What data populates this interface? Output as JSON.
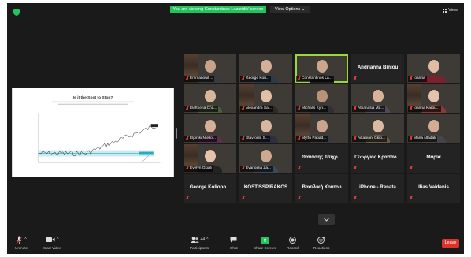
{
  "top_bar": {
    "banner": "You are viewing Constantinos Lazaridis' screen",
    "view_options": "View Options",
    "view_label": "View"
  },
  "shared_slide": {
    "title": "Is it the Spot to Stop?"
  },
  "participants": [
    {
      "name": "Emmanouil ...",
      "style": "video",
      "face": "#c7a489",
      "shirt": "#3a3a3a",
      "muted": true
    },
    {
      "name": "George Kou...",
      "style": "video",
      "face": "#d4b096",
      "shirt": "#2c3a4a",
      "muted": true
    },
    {
      "name": "Constantinos La...",
      "style": "video",
      "face": "#caa68c",
      "shirt": "#1e1e1e",
      "muted": true,
      "active": true
    },
    {
      "name": "Andrianna Biniou",
      "style": "name",
      "muted": true
    },
    {
      "name": "Ioanna",
      "style": "video",
      "face": "#e0bca4",
      "shirt": "#7a2130",
      "muted": true
    },
    {
      "name": "Eleftheria Cha...",
      "style": "video",
      "face": "#d9b59c",
      "shirt": "#4c5c3c",
      "muted": true
    },
    {
      "name": "Alexandra Sa...",
      "style": "video",
      "face": "#e2c0a8",
      "shirt": "#2a2a2a",
      "muted": true
    },
    {
      "name": "Michalis Kyri...",
      "style": "video",
      "face": "#b89378",
      "shirt": "#303030",
      "muted": true
    },
    {
      "name": "Athanasia Ma...",
      "style": "video",
      "face": "#d8b39a",
      "shirt": "#4a4a5a",
      "muted": true
    },
    {
      "name": "Ioanna Karou...",
      "style": "video",
      "face": "#e4c3aa",
      "shirt": "#8a3a3a",
      "muted": true
    },
    {
      "name": "Elpiniki Ntelio...",
      "style": "video",
      "face": "#d6b197",
      "shirt": "#5a3050",
      "muted": true
    },
    {
      "name": "Stavroula S...",
      "style": "video",
      "face": "#d9b69e",
      "shirt": "#2e2e3e",
      "muted": true
    },
    {
      "name": "Myrto Papad...",
      "style": "video",
      "face": "#caa48a",
      "shirt": "#3a3a3a",
      "muted": true
    },
    {
      "name": "Aikaterini Gkio...",
      "style": "video",
      "face": "#dcb9a0",
      "shirt": "#6a5a4a",
      "muted": true
    },
    {
      "name": "Maria Ntadali",
      "style": "video",
      "face": "#d2ad93",
      "shirt": "#454545",
      "muted": true
    },
    {
      "name": "Evelyn Gkiali",
      "style": "video",
      "face": "#e5c4ab",
      "shirt": "#222222",
      "muted": true
    },
    {
      "name": "Evangelia Za...",
      "style": "video",
      "face": "#cfa98f",
      "shirt": "#3a4a5a",
      "muted": true
    },
    {
      "name": "Θανάσης Τσιχρ...",
      "style": "name",
      "muted": true
    },
    {
      "name": "Γεώργιος Κρασάδ...",
      "style": "name",
      "muted": true
    },
    {
      "name": "Μαρία",
      "style": "name",
      "muted": true
    },
    {
      "name": "George Koliopo...",
      "style": "name",
      "muted": true
    },
    {
      "name": "KOSTISSPIRAKOS",
      "style": "name",
      "muted": true
    },
    {
      "name": "Βασιλική Κουτου",
      "style": "name",
      "muted": true
    },
    {
      "name": "iPhone - Renata",
      "style": "name",
      "muted": true
    },
    {
      "name": "Ilias Vaidanis",
      "style": "name",
      "muted": true
    }
  ],
  "toolbar": {
    "unmute": "Unmute",
    "start_video": "Start Video",
    "participants": "Participants",
    "participant_count": "44",
    "chat": "Chat",
    "share_screen": "Share Screen",
    "record": "Record",
    "reactions": "Reactions",
    "leave": "Leave"
  },
  "colors": {
    "background": "#1a1a1a",
    "banner": "#23c25c",
    "active_speaker": "#9bd63c",
    "leave": "#d9342b",
    "muted_icon": "#e23a3a"
  }
}
